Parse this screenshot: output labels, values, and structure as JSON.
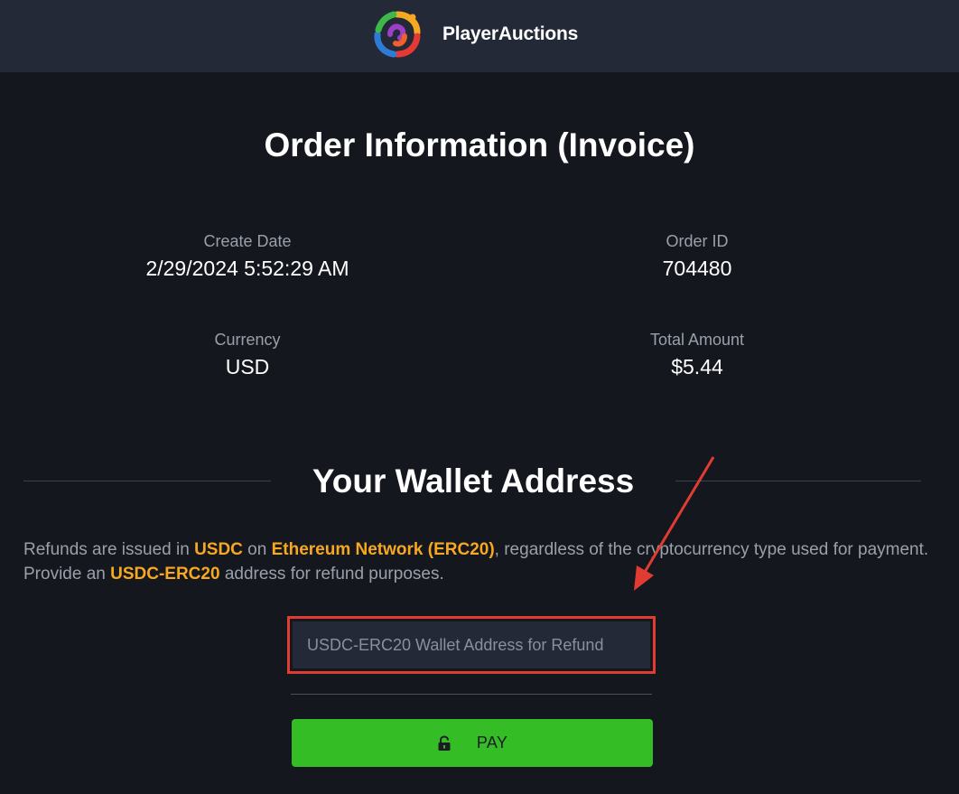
{
  "header": {
    "brand_name": "PlayerAuctions",
    "logo_icon": "playerauctions-logo-icon"
  },
  "page_title": "Order Information (Invoice)",
  "order_info": {
    "create_date_label": "Create Date",
    "create_date_value": "2/29/2024 5:52:29 AM",
    "order_id_label": "Order ID",
    "order_id_value": "704480",
    "currency_label": "Currency",
    "currency_value": "USD",
    "total_amount_label": "Total Amount",
    "total_amount_value": "$5.44"
  },
  "wallet": {
    "title": "Your Wallet Address",
    "note_part1": "Refunds are issued in ",
    "note_hl1": "USDC",
    "note_part2": " on ",
    "note_hl2": "Ethereum Network (ERC20)",
    "note_part3": ", regardless of the cryptocurrency type used for payment. Provide an ",
    "note_hl3": "USDC-ERC20",
    "note_part4": " address for refund purposes.",
    "input_placeholder": "USDC-ERC20 Wallet Address for Refund",
    "input_value": ""
  },
  "pay_button": {
    "label": "PAY",
    "icon": "lock-icon"
  },
  "colors": {
    "background": "#14171e",
    "header": "#232937",
    "highlight": "#f7a823",
    "pay_green": "#34bd25",
    "annotation_red": "#e03c31"
  }
}
